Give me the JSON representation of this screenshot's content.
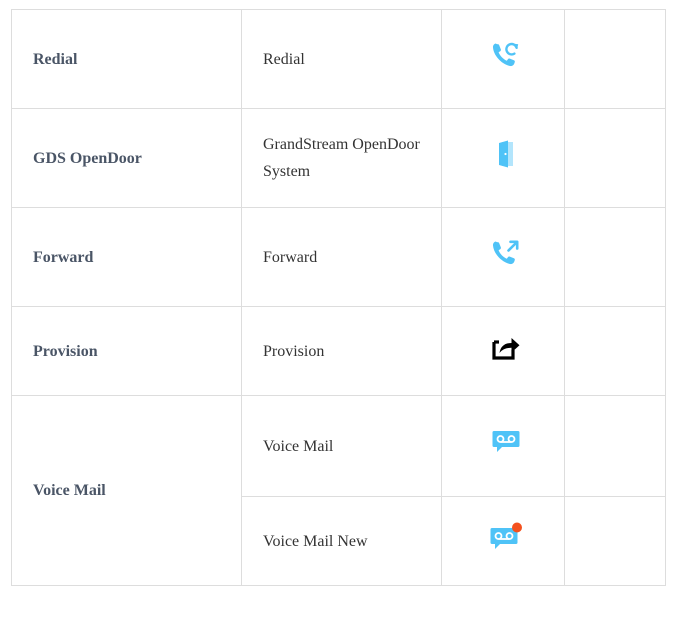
{
  "rows": [
    {
      "name": "Redial",
      "description": "Redial",
      "icon": "redial-icon",
      "icon_color": "#4fc3f7"
    },
    {
      "name": "GDS OpenDoor",
      "description": "GrandStream OpenDoor System",
      "icon": "open-door-icon",
      "icon_color": "#4fc3f7"
    },
    {
      "name": "Forward",
      "description": "Forward",
      "icon": "forward-call-icon",
      "icon_color": "#4fc3f7"
    },
    {
      "name": "Provision",
      "description": "Provision",
      "icon": "share-export-icon",
      "icon_color": "#000000"
    }
  ],
  "voice_mail": {
    "name": "Voice Mail",
    "items": [
      {
        "description": "Voice Mail",
        "icon": "voicemail-icon",
        "icon_color": "#4fc3f7"
      },
      {
        "description": "Voice Mail New",
        "icon": "voicemail-new-icon",
        "icon_color": "#4fc3f7",
        "badge_color": "#f4511e"
      }
    ]
  }
}
